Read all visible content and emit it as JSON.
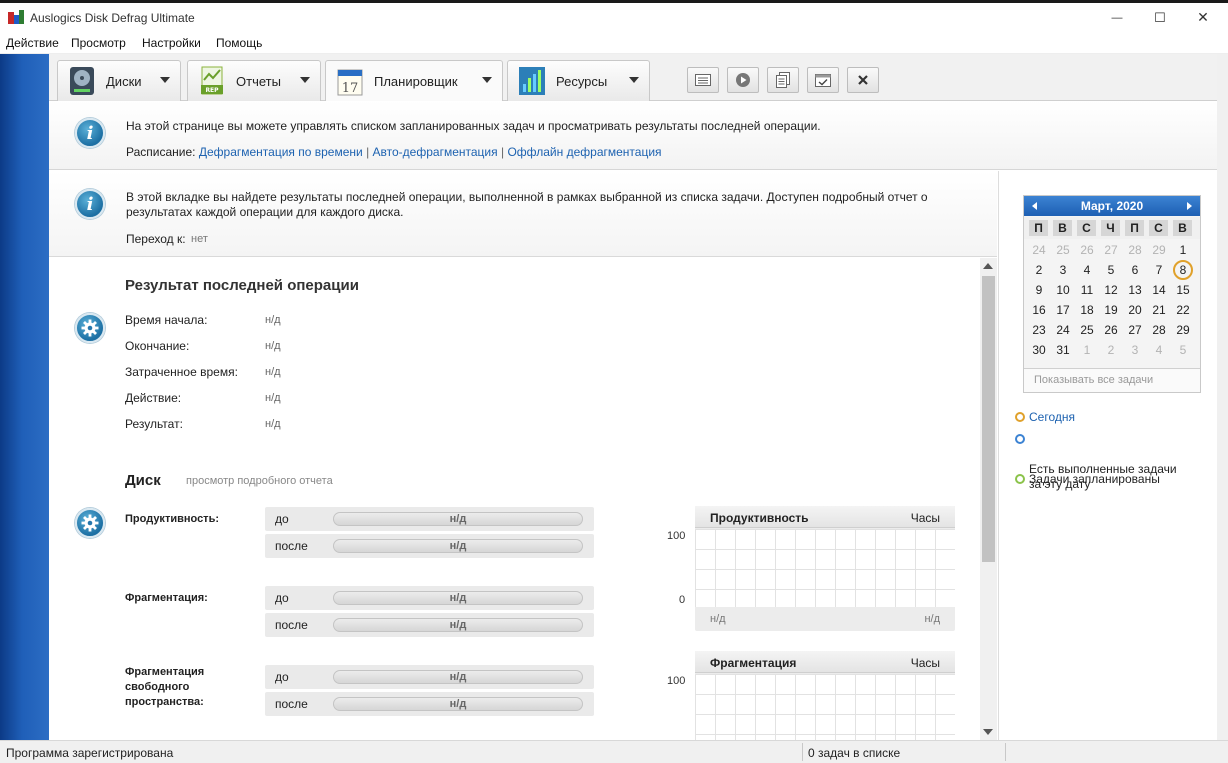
{
  "window": {
    "title": "Auslogics Disk Defrag Ultimate",
    "minimize_glyph": "—",
    "maximize_glyph": "☐",
    "close_glyph": "✕"
  },
  "menu": [
    "Действие",
    "Просмотр",
    "Настройки",
    "Помощь"
  ],
  "tabs": [
    {
      "label": "Диски",
      "icon": "disk-icon"
    },
    {
      "label": "Отчеты",
      "icon": "report-icon"
    },
    {
      "label": "Планировщик",
      "icon": "calendar-icon",
      "active": true
    },
    {
      "label": "Ресурсы",
      "icon": "resources-icon"
    }
  ],
  "toolbar": [
    {
      "name": "properties-button",
      "icon": "properties-icon"
    },
    {
      "name": "run-button",
      "icon": "play-icon"
    },
    {
      "name": "copy-button",
      "icon": "copy-icon"
    },
    {
      "name": "task-check-button",
      "icon": "task-check-icon"
    },
    {
      "name": "delete-button",
      "icon": "close-icon"
    }
  ],
  "header": {
    "text": "На этой странице вы можете управлять списком запланированных задач и просматривать результаты последней операции.",
    "schedule_label": "Расписание:",
    "links": [
      "Дефрагментация по времени",
      "Авто-дефрагментация",
      "Оффлайн дефрагментация"
    ],
    "separator": "|"
  },
  "info2": {
    "text_line1": "В этой вкладке вы найдете результаты последней операции, выполненной в рамках выбранной из списка задачи. Доступен подробный отчет о",
    "text_line2": "результатах каждой операции для каждого диска.",
    "goto_label": "Переход к:",
    "goto_value": "нет"
  },
  "last_op": {
    "title": "Результат последней операции",
    "rows": [
      {
        "label": "Время начала:",
        "value": "н/д"
      },
      {
        "label": "Окончание:",
        "value": "н/д"
      },
      {
        "label": "Затраченное время:",
        "value": "н/д"
      },
      {
        "label": "Действие:",
        "value": "н/д"
      },
      {
        "label": "Результат:",
        "value": "н/д"
      }
    ]
  },
  "disk": {
    "title": "Диск",
    "report_link": "просмотр подробного отчета",
    "metrics": [
      {
        "label": "Продуктивность:",
        "before_label": "до",
        "before": "н/д",
        "after_label": "после",
        "after": "н/д"
      },
      {
        "label": "Фрагментация:",
        "before_label": "до",
        "before": "н/д",
        "after_label": "после",
        "after": "н/д"
      },
      {
        "label": "Фрагментация\nсвободного\nпространства:",
        "before_label": "до",
        "before": "н/д",
        "after_label": "после",
        "after": "н/д"
      }
    ]
  },
  "graphs": [
    {
      "title": "Продуктивность",
      "unit": "Часы",
      "y_max": "100",
      "y_min": "0",
      "x_left": "н/д",
      "x_right": "н/д"
    },
    {
      "title": "Фрагментация",
      "unit": "Часы",
      "y_max": "100"
    }
  ],
  "calendar": {
    "month": "Март, 2020",
    "dows": [
      "П",
      "В",
      "С",
      "Ч",
      "П",
      "С",
      "В"
    ],
    "weeks": [
      [
        {
          "d": "24",
          "m": 1
        },
        {
          "d": "25",
          "m": 1
        },
        {
          "d": "26",
          "m": 1
        },
        {
          "d": "27",
          "m": 1
        },
        {
          "d": "28",
          "m": 1
        },
        {
          "d": "29",
          "m": 1
        },
        {
          "d": "1",
          "m": 0
        }
      ],
      [
        {
          "d": "2",
          "m": 0
        },
        {
          "d": "3",
          "m": 0
        },
        {
          "d": "4",
          "m": 0
        },
        {
          "d": "5",
          "m": 0
        },
        {
          "d": "6",
          "m": 0
        },
        {
          "d": "7",
          "m": 0
        },
        {
          "d": "8",
          "m": 0,
          "today": true
        }
      ],
      [
        {
          "d": "9",
          "m": 0
        },
        {
          "d": "10",
          "m": 0
        },
        {
          "d": "11",
          "m": 0
        },
        {
          "d": "12",
          "m": 0
        },
        {
          "d": "13",
          "m": 0
        },
        {
          "d": "14",
          "m": 0
        },
        {
          "d": "15",
          "m": 0
        }
      ],
      [
        {
          "d": "16",
          "m": 0
        },
        {
          "d": "17",
          "m": 0
        },
        {
          "d": "18",
          "m": 0
        },
        {
          "d": "19",
          "m": 0
        },
        {
          "d": "20",
          "m": 0
        },
        {
          "d": "21",
          "m": 0
        },
        {
          "d": "22",
          "m": 0
        }
      ],
      [
        {
          "d": "23",
          "m": 0
        },
        {
          "d": "24",
          "m": 0
        },
        {
          "d": "25",
          "m": 0
        },
        {
          "d": "26",
          "m": 0
        },
        {
          "d": "27",
          "m": 0
        },
        {
          "d": "28",
          "m": 0
        },
        {
          "d": "29",
          "m": 0
        }
      ],
      [
        {
          "d": "30",
          "m": 0
        },
        {
          "d": "31",
          "m": 0
        },
        {
          "d": "1",
          "m": 1
        },
        {
          "d": "2",
          "m": 1
        },
        {
          "d": "3",
          "m": 1
        },
        {
          "d": "4",
          "m": 1
        },
        {
          "d": "5",
          "m": 1
        }
      ]
    ],
    "show_all": "Показывать все задачи",
    "today_color": "#e0a12b"
  },
  "legend": [
    {
      "label": "Сегодня",
      "color": "#e0a12b",
      "link": true
    },
    {
      "label": "Есть выполненные задачи\nза эту дату",
      "color": "#3c83d3"
    },
    {
      "label": "Задачи запланированы",
      "color": "#8bc34a"
    }
  ],
  "status": {
    "left": "Программа зарегистрирована",
    "right": "0 задач в списке"
  },
  "colors": {
    "accent": "#1d62b0",
    "sidebar_blue": "#1f5fb8",
    "calendar_head": "#2a6fc4"
  }
}
